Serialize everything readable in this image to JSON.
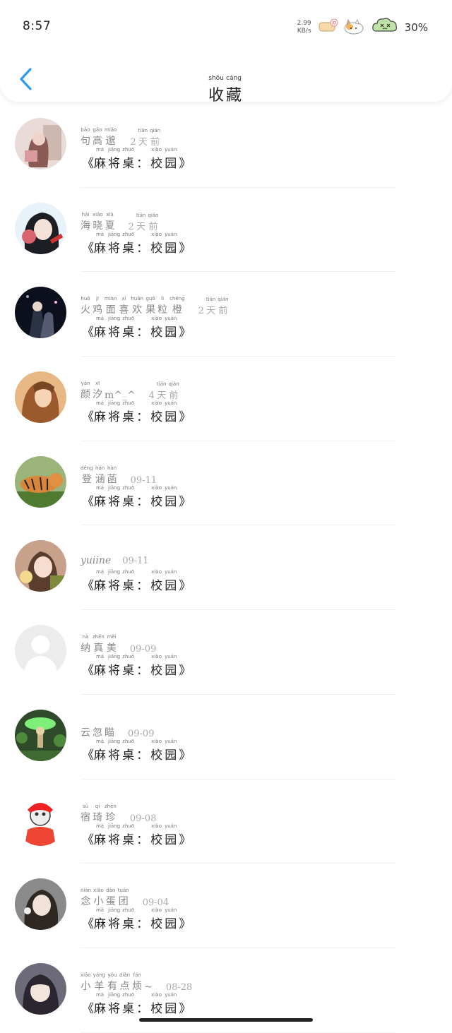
{
  "status_bar": {
    "time": "8:57",
    "net_speed_value": "2.99",
    "net_speed_unit": "KB/s",
    "battery": "30%"
  },
  "header": {
    "title": [
      {
        "ch": "收",
        "py": "shōu"
      },
      {
        "ch": "藏",
        "py": "cáng"
      }
    ]
  },
  "items": [
    {
      "name": [
        {
          "ch": "句",
          "py": "bāo"
        },
        {
          "ch": "高",
          "py": "gāo"
        },
        {
          "ch": "邈",
          "py": "miǎo"
        }
      ],
      "date": [
        {
          "ch": "2",
          "py": ""
        },
        {
          "ch": "天",
          "py": "tiān"
        },
        {
          "ch": "前",
          "py": "qián"
        }
      ],
      "game": [
        {
          "ch": "麻",
          "py": "má"
        },
        {
          "ch": "将",
          "py": "jiāng"
        },
        {
          "ch": "桌",
          "py": "zhuō"
        },
        {
          "ch": "：",
          "py": ""
        },
        {
          "ch": "校",
          "py": "xiào"
        },
        {
          "ch": "园",
          "py": "yuán"
        }
      ]
    },
    {
      "name": [
        {
          "ch": "海",
          "py": "hǎi"
        },
        {
          "ch": "晓",
          "py": "xiǎo"
        },
        {
          "ch": "夏",
          "py": "xià"
        }
      ],
      "date": [
        {
          "ch": "2",
          "py": ""
        },
        {
          "ch": "天",
          "py": "tiān"
        },
        {
          "ch": "前",
          "py": "qián"
        }
      ],
      "game": [
        {
          "ch": "麻",
          "py": "má"
        },
        {
          "ch": "将",
          "py": "jiāng"
        },
        {
          "ch": "桌",
          "py": "zhuō"
        },
        {
          "ch": "：",
          "py": ""
        },
        {
          "ch": "校",
          "py": "xiào"
        },
        {
          "ch": "园",
          "py": "yuán"
        }
      ]
    },
    {
      "name": [
        {
          "ch": "火",
          "py": "huǒ"
        },
        {
          "ch": "鸡",
          "py": "jī"
        },
        {
          "ch": "面",
          "py": "miàn"
        },
        {
          "ch": "喜",
          "py": "xǐ"
        },
        {
          "ch": "欢",
          "py": "huān"
        },
        {
          "ch": "果",
          "py": "guǒ"
        },
        {
          "ch": "粒",
          "py": "lì"
        },
        {
          "ch": "橙",
          "py": "chéng"
        }
      ],
      "date": [
        {
          "ch": "2",
          "py": ""
        },
        {
          "ch": "天",
          "py": "tiān"
        },
        {
          "ch": "前",
          "py": "qián"
        }
      ],
      "game": [
        {
          "ch": "麻",
          "py": "má"
        },
        {
          "ch": "将",
          "py": "jiāng"
        },
        {
          "ch": "桌",
          "py": "zhuō"
        },
        {
          "ch": "：",
          "py": ""
        },
        {
          "ch": "校",
          "py": "xiào"
        },
        {
          "ch": "园",
          "py": "yuán"
        }
      ]
    },
    {
      "name": [
        {
          "ch": "颜",
          "py": "yán"
        },
        {
          "ch": "汐",
          "py": "xī"
        },
        {
          "ch": "m^_^",
          "py": ""
        }
      ],
      "date": [
        {
          "ch": "4",
          "py": ""
        },
        {
          "ch": "天",
          "py": "tiān"
        },
        {
          "ch": "前",
          "py": "qián"
        }
      ],
      "game": [
        {
          "ch": "麻",
          "py": "má"
        },
        {
          "ch": "将",
          "py": "jiāng"
        },
        {
          "ch": "桌",
          "py": "zhuō"
        },
        {
          "ch": "：",
          "py": ""
        },
        {
          "ch": "校",
          "py": "xiào"
        },
        {
          "ch": "园",
          "py": "yuán"
        }
      ]
    },
    {
      "name": [
        {
          "ch": "登",
          "py": "dēng"
        },
        {
          "ch": "涵",
          "py": "hán"
        },
        {
          "ch": "菡",
          "py": "hàn"
        }
      ],
      "date": [
        {
          "ch": "09-11",
          "py": ""
        }
      ],
      "game": [
        {
          "ch": "麻",
          "py": "má"
        },
        {
          "ch": "将",
          "py": "jiāng"
        },
        {
          "ch": "桌",
          "py": "zhuō"
        },
        {
          "ch": "：",
          "py": ""
        },
        {
          "ch": "校",
          "py": "xiào"
        },
        {
          "ch": "园",
          "py": "yuán"
        }
      ]
    },
    {
      "name_plain": "yuiine",
      "date": [
        {
          "ch": "09-11",
          "py": ""
        }
      ],
      "game": [
        {
          "ch": "麻",
          "py": "má"
        },
        {
          "ch": "将",
          "py": "jiāng"
        },
        {
          "ch": "桌",
          "py": "zhuō"
        },
        {
          "ch": "：",
          "py": ""
        },
        {
          "ch": "校",
          "py": "xiào"
        },
        {
          "ch": "园",
          "py": "yuán"
        }
      ]
    },
    {
      "name": [
        {
          "ch": "纳",
          "py": "nà"
        },
        {
          "ch": "真",
          "py": "zhēn"
        },
        {
          "ch": "美",
          "py": "měi"
        }
      ],
      "date": [
        {
          "ch": "09-09",
          "py": ""
        }
      ],
      "game": [
        {
          "ch": "麻",
          "py": "má"
        },
        {
          "ch": "将",
          "py": "jiāng"
        },
        {
          "ch": "桌",
          "py": "zhuō"
        },
        {
          "ch": "：",
          "py": ""
        },
        {
          "ch": "校",
          "py": "xiào"
        },
        {
          "ch": "园",
          "py": "yuán"
        }
      ]
    },
    {
      "name": [
        {
          "ch": "云",
          "py": ""
        },
        {
          "ch": "忽",
          "py": ""
        },
        {
          "ch": "瞄",
          "py": ""
        }
      ],
      "date": [
        {
          "ch": "09-09",
          "py": ""
        }
      ],
      "game": [
        {
          "ch": "麻",
          "py": "má"
        },
        {
          "ch": "将",
          "py": "jiāng"
        },
        {
          "ch": "桌",
          "py": "zhuō"
        },
        {
          "ch": "：",
          "py": ""
        },
        {
          "ch": "校",
          "py": "xiào"
        },
        {
          "ch": "园",
          "py": "yuán"
        }
      ]
    },
    {
      "name": [
        {
          "ch": "宿",
          "py": "sù"
        },
        {
          "ch": "琦",
          "py": "qí"
        },
        {
          "ch": "珍",
          "py": "zhēn"
        }
      ],
      "date": [
        {
          "ch": "09-08",
          "py": ""
        }
      ],
      "game": [
        {
          "ch": "麻",
          "py": "má"
        },
        {
          "ch": "将",
          "py": "jiāng"
        },
        {
          "ch": "桌",
          "py": "zhuō"
        },
        {
          "ch": "：",
          "py": ""
        },
        {
          "ch": "校",
          "py": "xiào"
        },
        {
          "ch": "园",
          "py": "yuán"
        }
      ]
    },
    {
      "name": [
        {
          "ch": "念",
          "py": "niàn"
        },
        {
          "ch": "小",
          "py": "xiǎo"
        },
        {
          "ch": "蛋",
          "py": "dàn"
        },
        {
          "ch": "团",
          "py": "tuán"
        }
      ],
      "date": [
        {
          "ch": "09-04",
          "py": ""
        }
      ],
      "game": [
        {
          "ch": "麻",
          "py": "má"
        },
        {
          "ch": "将",
          "py": "jiāng"
        },
        {
          "ch": "桌",
          "py": "zhuō"
        },
        {
          "ch": "：",
          "py": ""
        },
        {
          "ch": "校",
          "py": "xiào"
        },
        {
          "ch": "园",
          "py": "yuán"
        }
      ]
    },
    {
      "name": [
        {
          "ch": "小",
          "py": "xiǎo"
        },
        {
          "ch": "羊",
          "py": "yáng"
        },
        {
          "ch": "有",
          "py": "yǒu"
        },
        {
          "ch": "点",
          "py": "diǎn"
        },
        {
          "ch": "烦",
          "py": "fán"
        },
        {
          "ch": "~",
          "py": ""
        }
      ],
      "date": [
        {
          "ch": "08-28",
          "py": ""
        }
      ],
      "game": [
        {
          "ch": "麻",
          "py": "má"
        },
        {
          "ch": "将",
          "py": "jiāng"
        },
        {
          "ch": "桌",
          "py": "zhuō"
        },
        {
          "ch": "：",
          "py": ""
        },
        {
          "ch": "校",
          "py": "xiào"
        },
        {
          "ch": "园",
          "py": "yuán"
        }
      ]
    }
  ],
  "game_left_bracket": "《",
  "game_right_bracket": "》",
  "colors": {
    "accent": "#2d9cf0",
    "text_primary": "#222222",
    "text_secondary": "#888888",
    "divider": "#f1f1f1"
  },
  "icons": {
    "back": "chevron-left-icon",
    "wechat_sticker": "cat-sticker-icon",
    "battery": "cloud-battery-icon"
  }
}
